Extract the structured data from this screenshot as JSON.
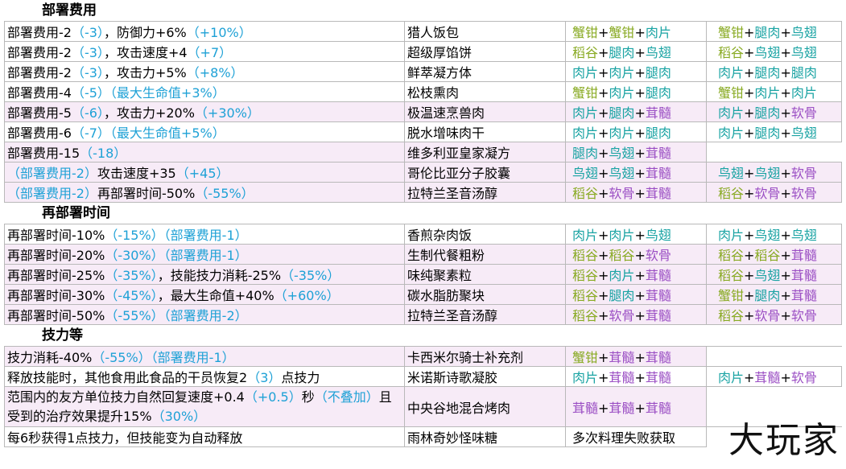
{
  "sections": [
    {
      "title": "部署费用",
      "rows": [
        {
          "effect": [
            [
              "部署费用-2",
              ""
            ],
            [
              "（-3）",
              "blue"
            ],
            [
              "，防御力+6%",
              ""
            ],
            [
              "（+10%）",
              "blue"
            ]
          ],
          "food": "猎人饭包",
          "recipe_a": [
            [
              "蟹钳",
              "#88aa22"
            ],
            [
              "+",
              ""
            ],
            [
              "蟹钳",
              "#88aa22"
            ],
            [
              "+",
              ""
            ],
            [
              "肉片",
              "#19a3a3"
            ]
          ],
          "recipe_b": [
            [
              "蟹钳",
              "#88aa22"
            ],
            [
              "+",
              ""
            ],
            [
              "腿肉",
              "#19a3a3"
            ],
            [
              "+",
              ""
            ],
            [
              "鸟翅",
              "#19a3a3"
            ]
          ]
        },
        {
          "effect": [
            [
              "部署费用-2",
              ""
            ],
            [
              "（-3）",
              "blue"
            ],
            [
              "，攻击速度+4",
              ""
            ],
            [
              "（+7）",
              "blue"
            ]
          ],
          "food": "超级厚馅饼",
          "recipe_a": [
            [
              "稻谷",
              "#88aa22"
            ],
            [
              "+",
              ""
            ],
            [
              "腿肉",
              "#19a3a3"
            ],
            [
              "+",
              ""
            ],
            [
              "鸟翅",
              "#19a3a3"
            ]
          ],
          "recipe_b": [
            [
              "稻谷",
              "#88aa22"
            ],
            [
              "+",
              ""
            ],
            [
              "鸟翅",
              "#19a3a3"
            ],
            [
              "+",
              ""
            ],
            [
              "鸟翅",
              "#19a3a3"
            ]
          ]
        },
        {
          "effect": [
            [
              "部署费用-2",
              ""
            ],
            [
              "（-3）",
              "blue"
            ],
            [
              "，攻击力+5%",
              ""
            ],
            [
              "（+8%）",
              "blue"
            ]
          ],
          "food": "鲜萃凝方体",
          "recipe_a": [
            [
              "肉片",
              "#19a3a3"
            ],
            [
              "+",
              ""
            ],
            [
              "肉片",
              "#19a3a3"
            ],
            [
              "+",
              ""
            ],
            [
              "腿肉",
              "#19a3a3"
            ]
          ],
          "recipe_b": [
            [
              "肉片",
              "#19a3a3"
            ],
            [
              "+",
              ""
            ],
            [
              "腿肉",
              "#19a3a3"
            ],
            [
              "+",
              ""
            ],
            [
              "腿肉",
              "#19a3a3"
            ]
          ]
        },
        {
          "effect": [
            [
              "部署费用-4",
              ""
            ],
            [
              "（-5）（最大生命值+3%）",
              "blue"
            ]
          ],
          "food": "松枝熏肉",
          "recipe_a": [
            [
              "蟹钳",
              "#88aa22"
            ],
            [
              "+",
              ""
            ],
            [
              "肉片",
              "#19a3a3"
            ],
            [
              "+",
              ""
            ],
            [
              "腿肉",
              "#19a3a3"
            ]
          ],
          "recipe_b": [
            [
              "蟹钳",
              "#88aa22"
            ],
            [
              "+",
              ""
            ],
            [
              "肉片",
              "#19a3a3"
            ],
            [
              "+",
              ""
            ],
            [
              "肉片",
              "#19a3a3"
            ]
          ]
        },
        {
          "pink": true,
          "effect": [
            [
              "部署费用-5",
              ""
            ],
            [
              "（-6）",
              "blue"
            ],
            [
              "，攻击力+20%",
              ""
            ],
            [
              "（+30%）",
              "blue"
            ]
          ],
          "food": "极温速烹兽肉",
          "recipe_a": [
            [
              "肉片",
              "#19a3a3"
            ],
            [
              "+",
              ""
            ],
            [
              "腿肉",
              "#19a3a3"
            ],
            [
              "+",
              ""
            ],
            [
              "茸髓",
              "#9b4fc4"
            ]
          ],
          "recipe_b": [
            [
              "肉片",
              "#19a3a3"
            ],
            [
              "+",
              ""
            ],
            [
              "腿肉",
              "#19a3a3"
            ],
            [
              "+",
              ""
            ],
            [
              "软骨",
              "#9b4fc4"
            ]
          ]
        },
        {
          "effect": [
            [
              "部署费用-6",
              ""
            ],
            [
              "（-7）（最大生命值+5%）",
              "blue"
            ]
          ],
          "food": "脱水增味肉干",
          "recipe_a": [
            [
              "肉片",
              "#19a3a3"
            ],
            [
              "+",
              ""
            ],
            [
              "肉片",
              "#19a3a3"
            ],
            [
              "+",
              ""
            ],
            [
              "腿肉",
              "#19a3a3"
            ]
          ],
          "recipe_b": [
            [
              "肉片",
              "#19a3a3"
            ],
            [
              "+",
              ""
            ],
            [
              "腿肉",
              "#19a3a3"
            ],
            [
              "+",
              ""
            ],
            [
              "鸟翅",
              "#19a3a3"
            ]
          ]
        },
        {
          "pink": true,
          "effect": [
            [
              "部署费用-15",
              ""
            ],
            [
              "（-18）",
              "blue"
            ]
          ],
          "food": "维多利亚皇家凝方",
          "recipe_a": [
            [
              "腿肉",
              "#19a3a3"
            ],
            [
              "+",
              ""
            ],
            [
              "鸟翅",
              "#19a3a3"
            ],
            [
              "+",
              ""
            ],
            [
              "茸髓",
              "#9b4fc4"
            ]
          ],
          "recipe_b": []
        },
        {
          "pink": true,
          "effect": [
            [
              "（部署费用-2）",
              "blue"
            ],
            [
              "攻击速度+35",
              ""
            ],
            [
              "（+45）",
              "blue"
            ]
          ],
          "food": "哥伦比亚分子胶囊",
          "recipe_a": [
            [
              "鸟翅",
              "#19a3a3"
            ],
            [
              "+",
              ""
            ],
            [
              "鸟翅",
              "#19a3a3"
            ],
            [
              "+",
              ""
            ],
            [
              "茸髓",
              "#9b4fc4"
            ]
          ],
          "recipe_b": [
            [
              "鸟翅",
              "#19a3a3"
            ],
            [
              "+",
              ""
            ],
            [
              "鸟翅",
              "#19a3a3"
            ],
            [
              "+",
              ""
            ],
            [
              "软骨",
              "#9b4fc4"
            ]
          ]
        },
        {
          "pink": true,
          "effect": [
            [
              "（部署费用-2）",
              "blue"
            ],
            [
              "再部署时间-50%",
              ""
            ],
            [
              "（-55%）",
              "blue"
            ]
          ],
          "food": "拉特兰圣音汤醇",
          "recipe_a": [
            [
              "稻谷",
              "#88aa22"
            ],
            [
              "+",
              ""
            ],
            [
              "软骨",
              "#9b4fc4"
            ],
            [
              "+",
              ""
            ],
            [
              "茸髓",
              "#9b4fc4"
            ]
          ],
          "recipe_b": [
            [
              "稻谷",
              "#88aa22"
            ],
            [
              "+",
              ""
            ],
            [
              "软骨",
              "#9b4fc4"
            ],
            [
              "+",
              ""
            ],
            [
              "软骨",
              "#9b4fc4"
            ]
          ]
        }
      ]
    },
    {
      "title": "再部署时间",
      "rows": [
        {
          "effect": [
            [
              "再部署时间-10%",
              ""
            ],
            [
              "（-15%）（部署费用-1）",
              "blue"
            ]
          ],
          "food": "香煎杂肉饭",
          "recipe_a": [
            [
              "肉片",
              "#19a3a3"
            ],
            [
              "+",
              ""
            ],
            [
              "肉片",
              "#19a3a3"
            ],
            [
              "+",
              ""
            ],
            [
              "鸟翅",
              "#19a3a3"
            ]
          ],
          "recipe_b": [
            [
              "肉片",
              "#19a3a3"
            ],
            [
              "+",
              ""
            ],
            [
              "鸟翅",
              "#19a3a3"
            ],
            [
              "+",
              ""
            ],
            [
              "鸟翅",
              "#19a3a3"
            ]
          ]
        },
        {
          "pink": true,
          "effect": [
            [
              "再部署时间-20%",
              ""
            ],
            [
              "（-30%）（部署费用-1）",
              "blue"
            ]
          ],
          "food": "生制代餐粗粉",
          "recipe_a": [
            [
              "稻谷",
              "#88aa22"
            ],
            [
              "+",
              ""
            ],
            [
              "稻谷",
              "#88aa22"
            ],
            [
              "+",
              ""
            ],
            [
              "软骨",
              "#9b4fc4"
            ]
          ],
          "recipe_b": [
            [
              "稻谷",
              "#88aa22"
            ],
            [
              "+",
              ""
            ],
            [
              "稻谷",
              "#88aa22"
            ],
            [
              "+",
              ""
            ],
            [
              "茸髓",
              "#9b4fc4"
            ]
          ]
        },
        {
          "pink": true,
          "effect": [
            [
              "再部署时间-25%",
              ""
            ],
            [
              "（-35%）",
              "blue"
            ],
            [
              "，技能技力消耗-25%",
              ""
            ],
            [
              "（-35%）",
              "blue"
            ]
          ],
          "food": "味纯聚素粒",
          "recipe_a": [
            [
              "稻谷",
              "#88aa22"
            ],
            [
              "+",
              ""
            ],
            [
              "肉片",
              "#19a3a3"
            ],
            [
              "+",
              ""
            ],
            [
              "茸髓",
              "#9b4fc4"
            ]
          ],
          "recipe_b": [
            [
              "稻谷",
              "#88aa22"
            ],
            [
              "+",
              ""
            ],
            [
              "鸟翅",
              "#19a3a3"
            ],
            [
              "+",
              ""
            ],
            [
              "茸髓",
              "#9b4fc4"
            ]
          ]
        },
        {
          "pink": true,
          "effect": [
            [
              "再部署时间-30%",
              ""
            ],
            [
              "（-45%）",
              "blue"
            ],
            [
              "，最大生命值+40%",
              ""
            ],
            [
              "（+60%）",
              "blue"
            ]
          ],
          "food": "碳水脂肪聚块",
          "recipe_a": [
            [
              "稻谷",
              "#88aa22"
            ],
            [
              "+",
              ""
            ],
            [
              "腿肉",
              "#19a3a3"
            ],
            [
              "+",
              ""
            ],
            [
              "茸髓",
              "#9b4fc4"
            ]
          ],
          "recipe_b": [
            [
              "蟹钳",
              "#88aa22"
            ],
            [
              "+",
              ""
            ],
            [
              "腿肉",
              "#19a3a3"
            ],
            [
              "+",
              ""
            ],
            [
              "茸髓",
              "#9b4fc4"
            ]
          ]
        },
        {
          "pink": true,
          "effect": [
            [
              "再部署时间-50%",
              ""
            ],
            [
              "（-55%）（部署费用-2）",
              "blue"
            ]
          ],
          "food": "拉特兰圣音汤醇",
          "recipe_a": [
            [
              "稻谷",
              "#88aa22"
            ],
            [
              "+",
              ""
            ],
            [
              "软骨",
              "#9b4fc4"
            ],
            [
              "+",
              ""
            ],
            [
              "茸髓",
              "#9b4fc4"
            ]
          ],
          "recipe_b": [
            [
              "稻谷",
              "#88aa22"
            ],
            [
              "+",
              ""
            ],
            [
              "软骨",
              "#9b4fc4"
            ],
            [
              "+",
              ""
            ],
            [
              "软骨",
              "#9b4fc4"
            ]
          ]
        }
      ]
    },
    {
      "title": "技力等",
      "rows": [
        {
          "pink": true,
          "effect": [
            [
              "技力消耗-40%",
              ""
            ],
            [
              "（-55%）（部署费用-1）",
              "blue"
            ]
          ],
          "food": "卡西米尔骑士补充剂",
          "recipe_a": [
            [
              "蟹钳",
              "#88aa22"
            ],
            [
              "+",
              ""
            ],
            [
              "茸髓",
              "#9b4fc4"
            ],
            [
              "+",
              ""
            ],
            [
              "茸髓",
              "#9b4fc4"
            ]
          ],
          "recipe_b": []
        },
        {
          "effect": [
            [
              "释放技能时，其他食用此食品的干员恢复2",
              ""
            ],
            [
              "（3）",
              "blue"
            ],
            [
              "点技力",
              ""
            ]
          ],
          "food": "米诺斯诗歌凝胶",
          "recipe_a": [
            [
              "肉片",
              "#19a3a3"
            ],
            [
              "+",
              ""
            ],
            [
              "茸髓",
              "#9b4fc4"
            ],
            [
              "+",
              ""
            ],
            [
              "茸髓",
              "#9b4fc4"
            ]
          ],
          "recipe_b": [
            [
              "肉片",
              "#19a3a3"
            ],
            [
              "+",
              ""
            ],
            [
              "茸髓",
              "#9b4fc4"
            ],
            [
              "+",
              ""
            ],
            [
              "软骨",
              "#9b4fc4"
            ]
          ]
        },
        {
          "pink": true,
          "multi": true,
          "effect": [
            [
              "范围内的友方单位技力自然回复速度+0.4",
              ""
            ],
            [
              "（+0.5）",
              "blue"
            ],
            [
              "秒",
              ""
            ],
            [
              "（不叠加）",
              "blue"
            ],
            [
              "且受到的治疗效果提升15%",
              ""
            ],
            [
              "（30%）",
              "blue"
            ]
          ],
          "food": "中央谷地混合烤肉",
          "recipe_a": [
            [
              "茸髓",
              "#9b4fc4"
            ],
            [
              "+",
              ""
            ],
            [
              "茸髓",
              "#9b4fc4"
            ],
            [
              "+",
              ""
            ],
            [
              "茸髓",
              "#9b4fc4"
            ]
          ],
          "recipe_b": []
        },
        {
          "effect": [
            [
              "每6秒获得1点技力，但技能变为自动释放",
              ""
            ]
          ],
          "food": "雨林奇妙怪味糖",
          "recipe_a": [
            [
              "多次料理失败获取",
              ""
            ]
          ],
          "recipe_b": []
        }
      ]
    }
  ],
  "watermark": "大玩家"
}
